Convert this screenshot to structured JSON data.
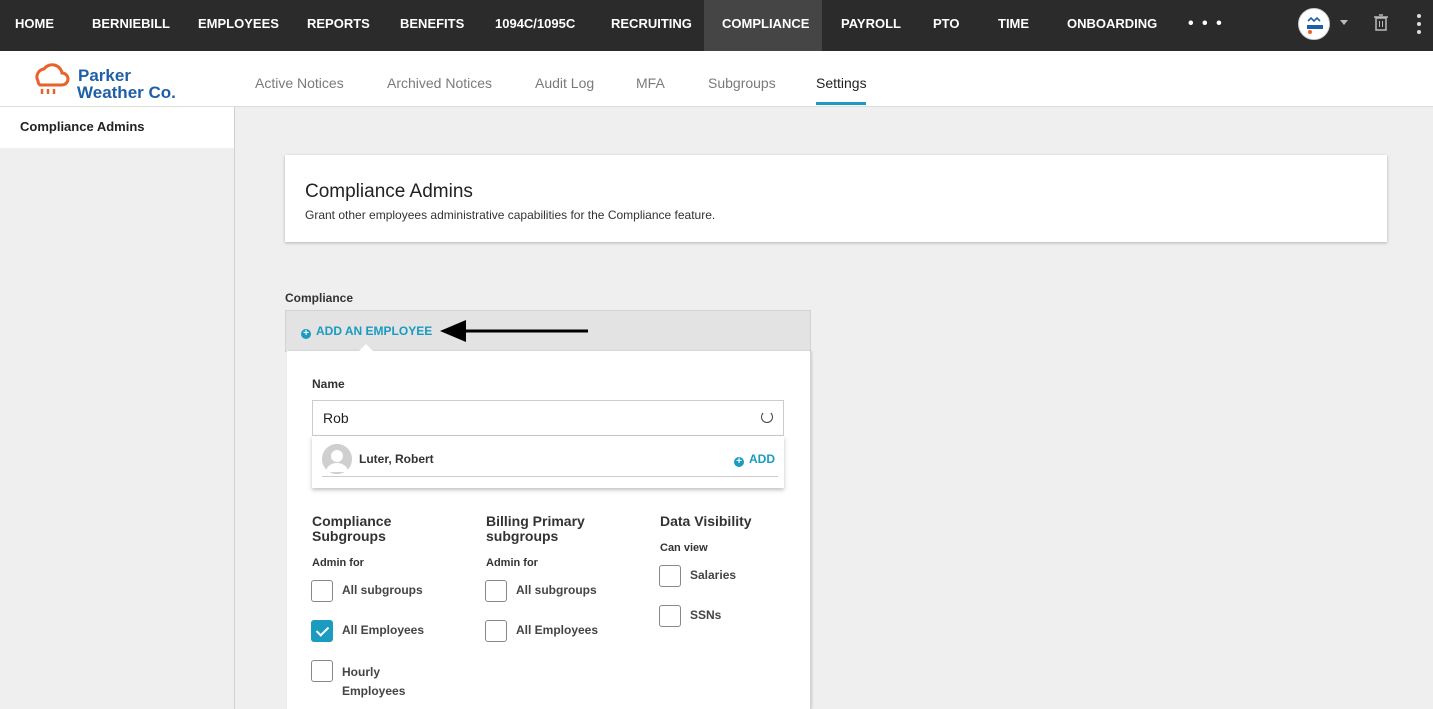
{
  "topnav": {
    "items": [
      "HOME",
      "BERNIEBILL",
      "EMPLOYEES",
      "REPORTS",
      "BENEFITS",
      "1094C/1095C",
      "RECRUITING",
      "COMPLIANCE",
      "PAYROLL",
      "PTO",
      "TIME",
      "ONBOARDING"
    ],
    "active": "COMPLIANCE",
    "more": "• • •"
  },
  "brand": {
    "line1": "Parker",
    "line2": "Weather Co.",
    "color": "#1f5fa8",
    "icon_color": "#e8622c"
  },
  "subnav": {
    "tabs": [
      "Active Notices",
      "Archived Notices",
      "Audit Log",
      "MFA",
      "Subgroups",
      "Settings"
    ],
    "active": "Settings"
  },
  "sidebar": {
    "items": [
      "Compliance Admins"
    ]
  },
  "header": {
    "title": "Compliance Admins",
    "description": "Grant other employees administrative capabilities for the Compliance feature."
  },
  "section": {
    "label": "Compliance",
    "add_button": "ADD AN EMPLOYEE"
  },
  "form": {
    "name_label": "Name",
    "name_value": "Rob",
    "result": {
      "name": "Luter, Robert",
      "add_label": "ADD"
    }
  },
  "columns": {
    "compliance": {
      "title": "Compliance Subgroups",
      "sub": "Admin for",
      "options": [
        {
          "label": "All subgroups",
          "checked": false
        },
        {
          "label": "All Employees",
          "checked": true
        },
        {
          "label": "Hourly Employees",
          "checked": false
        }
      ]
    },
    "billing": {
      "title": "Billing Primary subgroups",
      "sub": "Admin for",
      "options": [
        {
          "label": "All subgroups",
          "checked": false
        },
        {
          "label": "All Employees",
          "checked": false
        }
      ]
    },
    "visibility": {
      "title": "Data Visibility",
      "sub": "Can view",
      "options": [
        {
          "label": "Salaries",
          "checked": false
        },
        {
          "label": "SSNs",
          "checked": false
        }
      ]
    }
  },
  "colors": {
    "accent": "#1a9bbf",
    "topbar": "#2b2b2b"
  }
}
